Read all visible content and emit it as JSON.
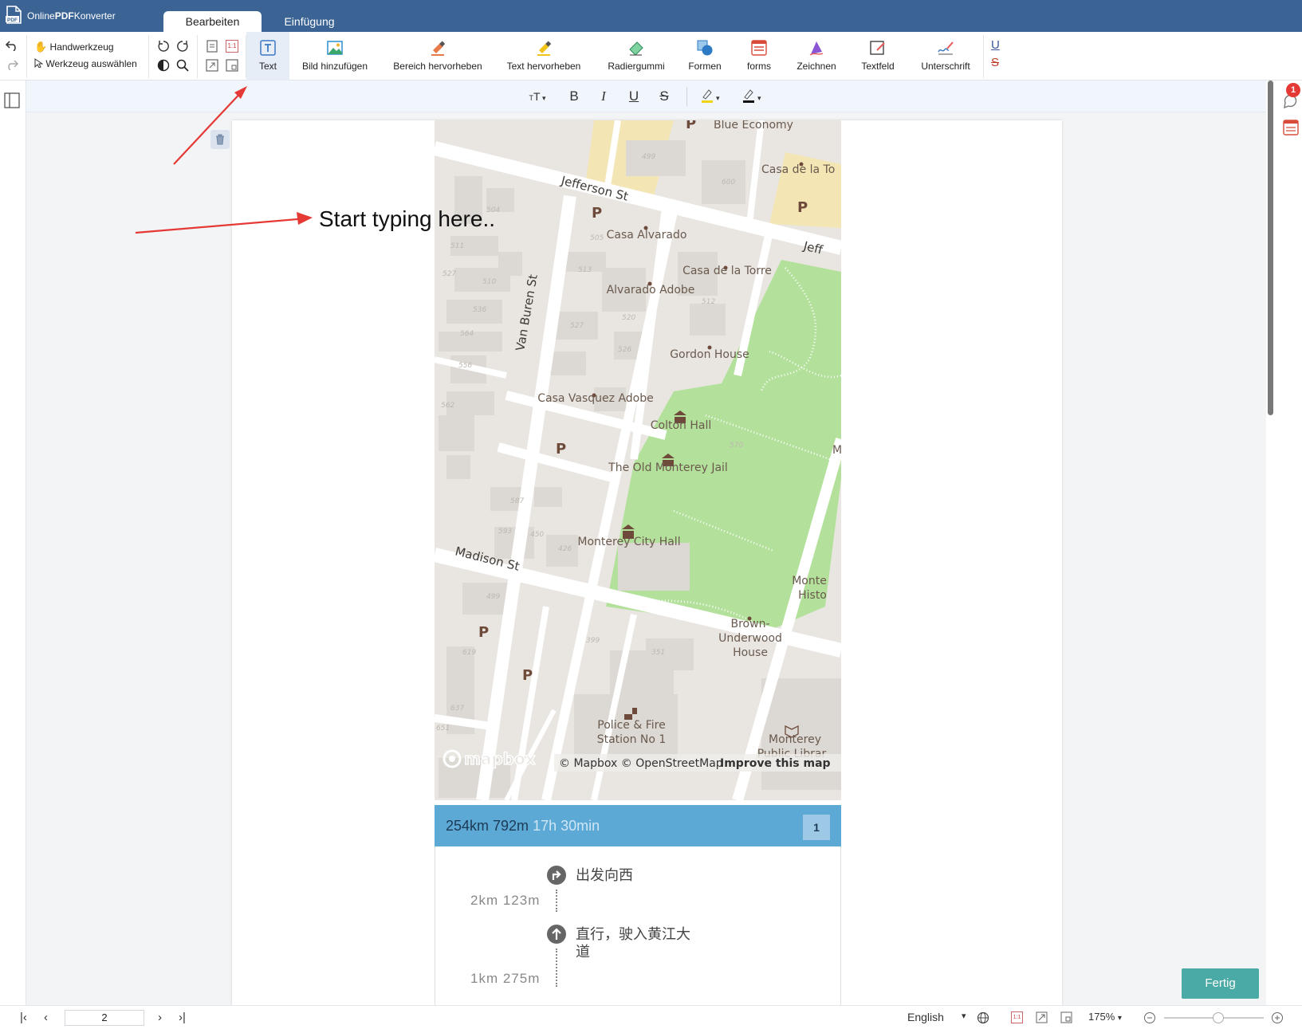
{
  "app": {
    "brand_prefix": "Online",
    "brand_bold": "PDF",
    "brand_suffix": "Konverter"
  },
  "tabs": [
    {
      "label": "Bearbeiten"
    },
    {
      "label": "Einfügung"
    }
  ],
  "toolbar": {
    "hand_tool": "Handwerkzeug",
    "select_tool": "Werkzeug auswählen",
    "tools": [
      {
        "label": "Text"
      },
      {
        "label": "Bild hinzufügen"
      },
      {
        "label": "Bereich hervorheben"
      },
      {
        "label": "Text hervorheben"
      },
      {
        "label": "Radiergummi"
      },
      {
        "label": "Formen"
      },
      {
        "label": "forms"
      },
      {
        "label": "Zeichnen"
      },
      {
        "label": "Textfeld"
      },
      {
        "label": "Unterschrift"
      }
    ],
    "scale_glyph": "1:1"
  },
  "formatbar": {
    "size": "T",
    "bold": "B",
    "italic": "I",
    "underline": "U",
    "strike": "S"
  },
  "editor": {
    "hint": "Start typing here.."
  },
  "map": {
    "streets": [
      "Jefferson St",
      "Van Buren St",
      "Madison St",
      "Jeff"
    ],
    "places": [
      "Blue Economy",
      "Casa de la To",
      "Casa Alvarado",
      "Casa de la Torre",
      "Alvarado Adobe",
      "Gordon House",
      "Casa Vasquez Adobe",
      "Colton Hall",
      "The Old Monterey Jail",
      "Monterey City Hall",
      "Monte",
      "Histo",
      "Brown-",
      "Underwood",
      "House",
      "Police & Fire",
      "Station No 1",
      "Monterey",
      "Public Librar",
      "M"
    ],
    "parking": "P",
    "numbers": [
      "499",
      "600",
      "505",
      "504",
      "511",
      "527",
      "510",
      "513",
      "512",
      "536",
      "527",
      "520",
      "564",
      "526",
      "556",
      "562",
      "570",
      "587",
      "593",
      "450",
      "426",
      "499",
      "399",
      "351",
      "619",
      "637",
      "651"
    ],
    "logo_text": "mapbox",
    "attribution": "© Mapbox © OpenStreetMap",
    "improve": "Improve this map"
  },
  "route": {
    "distance": "254km 792m",
    "duration": "17h 30min",
    "badge": "1",
    "steps": [
      {
        "text": "出发向西",
        "dist": "2km 123m"
      },
      {
        "text": "直行，驶入黄江大",
        "text2": "道",
        "dist": "1km 275m"
      }
    ]
  },
  "notifications": "1",
  "done_button": "Fertig",
  "statusbar": {
    "page": "2",
    "language": "English",
    "zoom": "175%",
    "scale_glyph": "1:1"
  },
  "colors": {
    "titlebar": "#3b6494",
    "accent": "#4aaaa5",
    "route": "#5da9d6",
    "arrow": "#e53935"
  }
}
